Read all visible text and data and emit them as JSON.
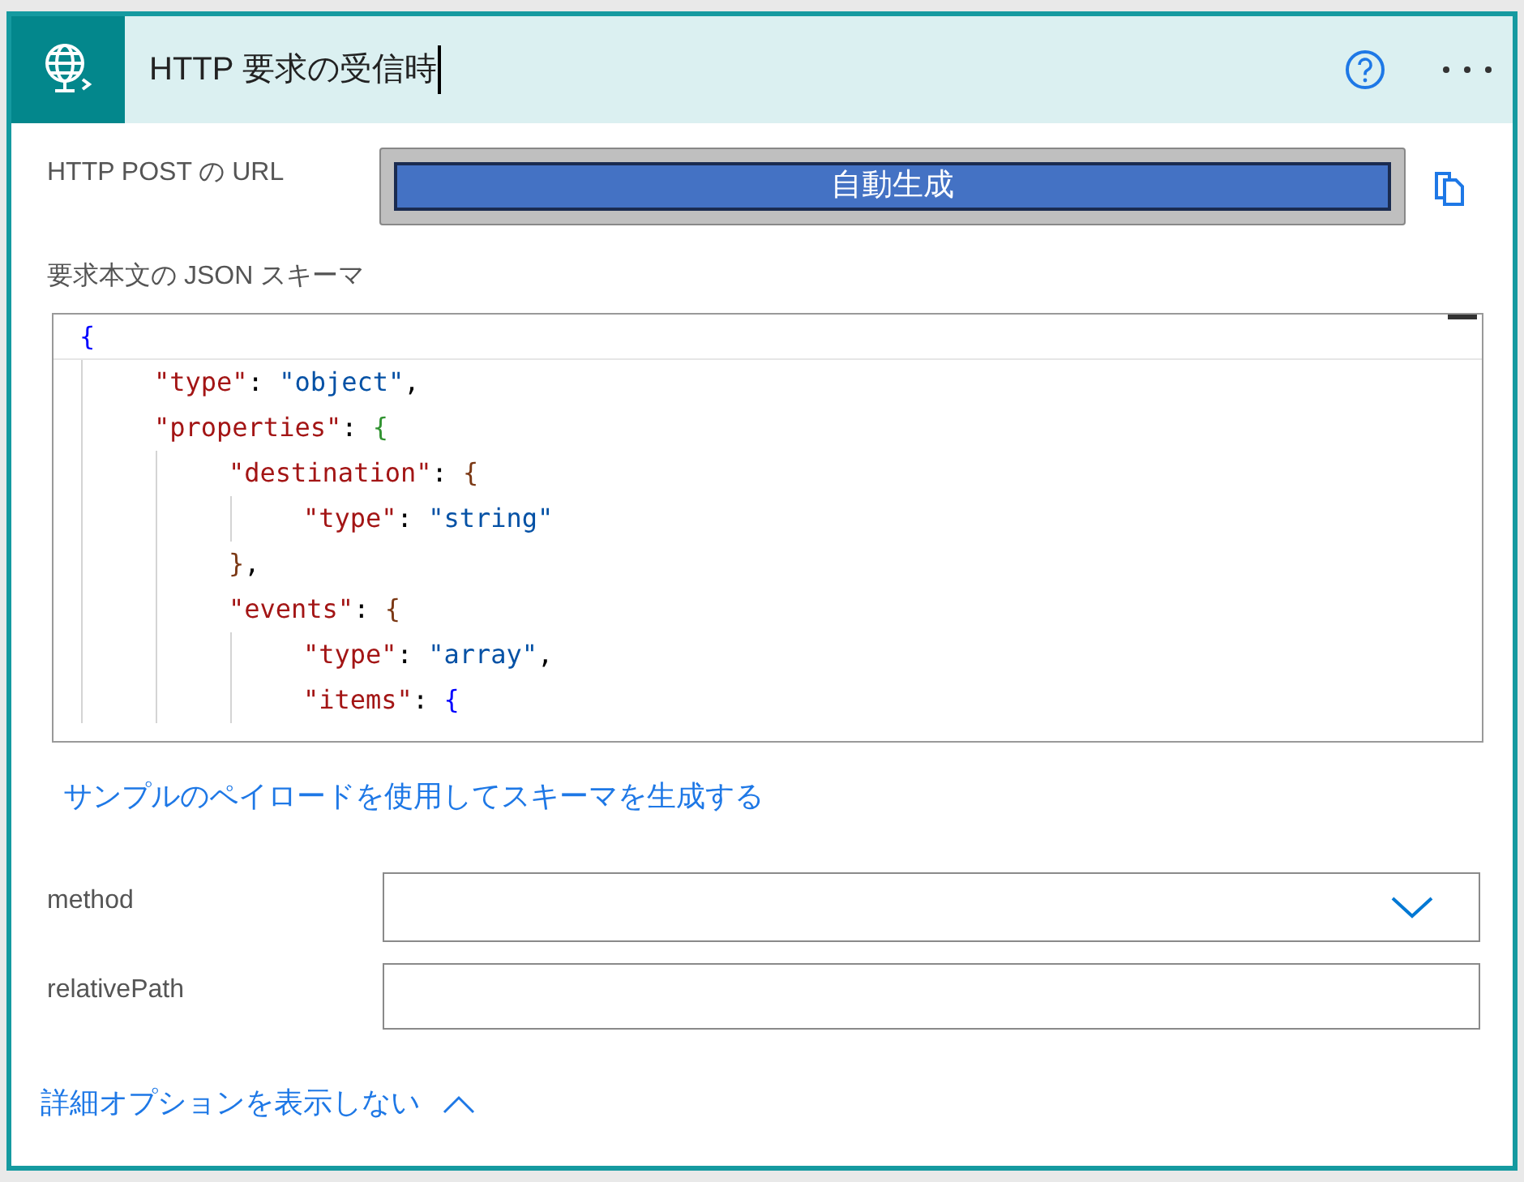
{
  "header": {
    "title": "HTTP 要求の受信時"
  },
  "url_field": {
    "label": "HTTP POST の URL",
    "value": "自動生成"
  },
  "schema": {
    "label": "要求本文の JSON スキーマ",
    "lines": [
      {
        "tokens": [
          {
            "kind": "brace",
            "text": "{"
          }
        ],
        "children": [
          {
            "tokens": [
              {
                "kind": "key",
                "text": "\"type\""
              },
              {
                "kind": "punct",
                "text": ": "
              },
              {
                "kind": "string",
                "text": "\"object\""
              },
              {
                "kind": "punct",
                "text": ","
              }
            ]
          },
          {
            "tokens": [
              {
                "kind": "key",
                "text": "\"properties\""
              },
              {
                "kind": "punct",
                "text": ": "
              },
              {
                "kind": "brace",
                "text": "{"
              }
            ],
            "children": [
              {
                "tokens": [
                  {
                    "kind": "key",
                    "text": "\"destination\""
                  },
                  {
                    "kind": "punct",
                    "text": ": "
                  },
                  {
                    "kind": "brace",
                    "text": "{"
                  }
                ],
                "children": [
                  {
                    "tokens": [
                      {
                        "kind": "key",
                        "text": "\"type\""
                      },
                      {
                        "kind": "punct",
                        "text": ": "
                      },
                      {
                        "kind": "string",
                        "text": "\"string\""
                      }
                    ]
                  }
                ]
              },
              {
                "tokens": [
                  {
                    "kind": "brace",
                    "text": "}"
                  },
                  {
                    "kind": "punct",
                    "text": ","
                  }
                ]
              },
              {
                "tokens": [
                  {
                    "kind": "key",
                    "text": "\"events\""
                  },
                  {
                    "kind": "punct",
                    "text": ": "
                  },
                  {
                    "kind": "brace",
                    "text": "{"
                  }
                ],
                "children": [
                  {
                    "tokens": [
                      {
                        "kind": "key",
                        "text": "\"type\""
                      },
                      {
                        "kind": "punct",
                        "text": ": "
                      },
                      {
                        "kind": "string",
                        "text": "\"array\""
                      },
                      {
                        "kind": "punct",
                        "text": ","
                      }
                    ]
                  },
                  {
                    "tokens": [
                      {
                        "kind": "key",
                        "text": "\"items\""
                      },
                      {
                        "kind": "punct",
                        "text": ": "
                      },
                      {
                        "kind": "brace",
                        "text": "{"
                      }
                    ]
                  }
                ]
              }
            ]
          }
        ]
      }
    ]
  },
  "generate_link": "サンプルのペイロードを使用してスキーマを生成する",
  "fields": [
    {
      "kind": "dropdown",
      "label": "method"
    },
    {
      "kind": "text",
      "label": "relativePath"
    }
  ],
  "toggle_link": {
    "label": "詳細オプションを表示しない",
    "expanded": true
  }
}
